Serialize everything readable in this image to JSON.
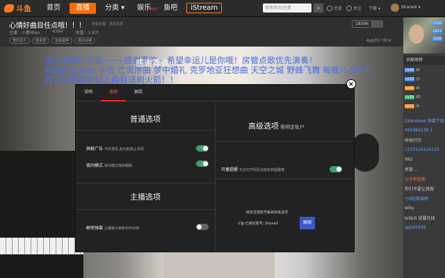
{
  "nav": {
    "logo": "斗鱼",
    "items": [
      "首页",
      "直播",
      "分类 ▾",
      "娱乐",
      "鱼吧"
    ],
    "hot_badge": "HOT",
    "istream": "iStream",
    "search_placeholder": "搜索房间/主播",
    "history": "历史",
    "follow": "关注",
    "download": "下载 ▾",
    "username": "ShaneX ▾"
  },
  "room": {
    "title": "心情好曲目任点哦！！！",
    "report": "查看举报　意见反馈",
    "host": "主播：小曹Miao",
    "viewers": "4384",
    "weight": "体重：3.87t",
    "tags": [
      "音乐达人",
      "技术流",
      "治愈歌声",
      "高冷女神"
    ],
    "follow_count": "18396",
    "app_link": "App扫一扫 ▾"
  },
  "ticker": {
    "line1": "请大家耐心点曲~~~感谢喜欢~ 希望幸运儿是你哦！房管点歌优先演奏！",
    "line2": "神曲summer 卡农 亡灵序曲  梦中婚礼  克罗地亚狂想曲   天空之城  野蜂飞舞 每晚八点准时",
    "line3": "其它时间如听以上曲目请刷火箭！！",
    "overlay": "感谢喜欢"
  },
  "sidebar": {
    "ranks": [
      {
        "lv": "LV26",
        "name": "ar",
        "color": "blue"
      },
      {
        "lv": "LV13",
        "name": "小",
        "color": "blue"
      },
      {
        "lv": "LV20",
        "name": "ai",
        "color": "orange"
      },
      {
        "lv": "LV20",
        "name": "sh",
        "color": "green"
      },
      {
        "lv": "LV11",
        "name": "lo",
        "color": "orange"
      }
    ],
    "section_title": "贡献周榜",
    "chat": [
      "DkAndrew  弹幕下线",
      "460482138  1",
      "时候打完",
      "1233124124123",
      "992",
      "房管  …",
      "公子和佳期",
      "你们不要让我做",
      "小5吃西城西",
      "wiky",
      "bilibili  说要在线",
      "qq545938"
    ]
  },
  "modal": {
    "tabs": [
      "说明",
      "选项",
      "抽奖"
    ],
    "active_tab": 1,
    "left": {
      "normal_title": "普通选项",
      "opt1_label": "屏蔽广告",
      "opt1_note": "不好意思,此功能禁止关闭",
      "opt1_on": true,
      "opt2_label": "夜间模式",
      "opt2_note": "夜间模式保护眼睛",
      "opt2_on": true,
      "host_title": "主播选项",
      "opt3_label": "解密弹幕",
      "opt3_note": "让弹幕大佬和你作对吧",
      "opt3_on": false
    },
    "right": {
      "advanced_title": "高级选项",
      "advanced_sub": "需绑定账户",
      "opt4_label": "开播提醒",
      "opt4_note": "无法打开网页也能收到提醒哦",
      "opt4_on": true,
      "bind_hint": "绑定任意账号解锁高级选项",
      "bind_account": "斗鱼-已绑定账号: ShaneX",
      "unbind": "解绑"
    }
  }
}
